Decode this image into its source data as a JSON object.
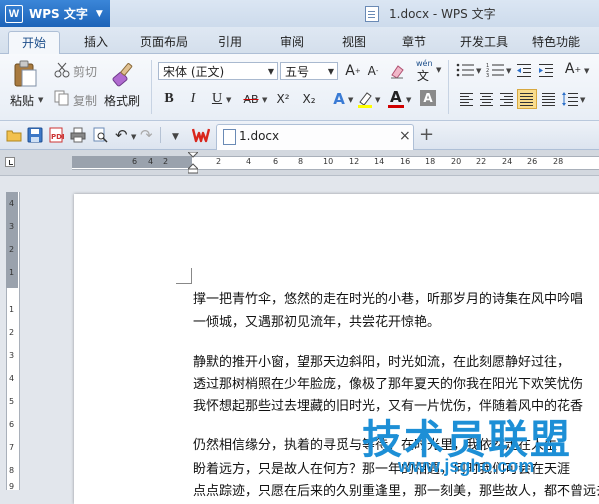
{
  "titlebar": {
    "app_logo": "W",
    "app_name": "WPS 文字",
    "app_dropdown": "▼",
    "document_title": "1.docx - WPS 文字"
  },
  "ribbon_tabs": [
    "开始",
    "插入",
    "页面布局",
    "引用",
    "审阅",
    "视图",
    "章节",
    "开发工具",
    "特色功能"
  ],
  "ribbon": {
    "paste_label": "粘贴",
    "cut_label": "剪切",
    "copy_label": "复制",
    "format_painter_label": "格式刷",
    "font_name": "宋体 (正文)",
    "font_size": "五号",
    "bold": "B",
    "italic": "I",
    "underline": "U",
    "strikethrough": "AB",
    "superscript": "X²",
    "subscript": "X₂",
    "phonetic_label": "wén",
    "phonetic_char": "文"
  },
  "doc_tab": {
    "name": "1.docx",
    "close": "×",
    "new_tab": "+"
  },
  "ruler": {
    "h_ticks": [
      "6",
      "4",
      "2",
      "2",
      "4",
      "6",
      "8",
      "10",
      "12",
      "14",
      "16",
      "18",
      "20",
      "22",
      "24",
      "26",
      "28"
    ],
    "v_ticks": [
      "4",
      "3",
      "2",
      "1",
      "1",
      "2",
      "3",
      "4",
      "5",
      "6",
      "7",
      "8",
      "9"
    ]
  },
  "document": {
    "lines": [
      "撑一把青竹伞，悠然的走在时光的小巷，听那岁月的诗集在风中吟唱",
      "一倾城，又遇那初见流年，共尝花开惊艳。",
      "静默的推开小窗，望那天边斜阳，时光如流，在此刻愿静好过往，",
      "透过那树梢照在少年脸庞，像极了那年夏天的你我在阳光下欢笑忧伤",
      "我怀想起那些过去埋藏的旧时光，又有一片忧伤，伴随着风中的花香",
      "仍然相信缘分，执着的寻觅与等待，在时光里，我依然走在人生",
      "盼着远方，只是故人在何方？那一年的相遇，何时我们可会在天涯",
      "点点踪迹，只愿在后来的久别重逢里，那一刻美，那些故人，都不曾远去"
    ]
  },
  "watermark": {
    "main": "技术员联盟",
    "url": "www.jsgho.com"
  },
  "colors": {
    "app_button": "#1c63b8",
    "accent": "#1c4e8a",
    "watermark": "#1d8fd6"
  }
}
